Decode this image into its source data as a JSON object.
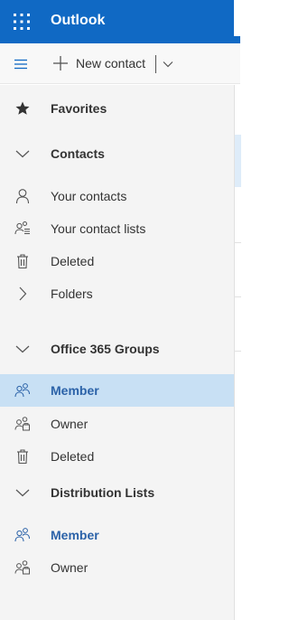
{
  "header": {
    "app_name": "Outlook"
  },
  "command_bar": {
    "new_contact_label": "New contact"
  },
  "colors": {
    "brand": "#1069c4",
    "selected_bg": "#c8e0f4",
    "accent_text": "#2b62a8",
    "nav_bg": "#f4f4f4"
  },
  "nav": {
    "favorites": "Favorites",
    "contacts_header": "Contacts",
    "your_contacts": "Your contacts",
    "your_contact_lists": "Your contact lists",
    "contacts_deleted": "Deleted",
    "folders": "Folders",
    "groups_header": "Office 365 Groups",
    "groups_member": "Member",
    "groups_owner": "Owner",
    "groups_deleted": "Deleted",
    "dl_header": "Distribution Lists",
    "dl_member": "Member",
    "dl_owner": "Owner"
  },
  "icons": {
    "waffle": "app-launcher-icon",
    "hamburger": "menu-icon",
    "plus": "plus-icon",
    "chevron": "chevron-down-icon",
    "star": "star-icon",
    "person": "person-icon",
    "contact_list": "contact-list-icon",
    "trash": "trash-icon",
    "chevron_right": "chevron-right-icon",
    "people": "people-icon",
    "owner": "people-owner-icon"
  }
}
